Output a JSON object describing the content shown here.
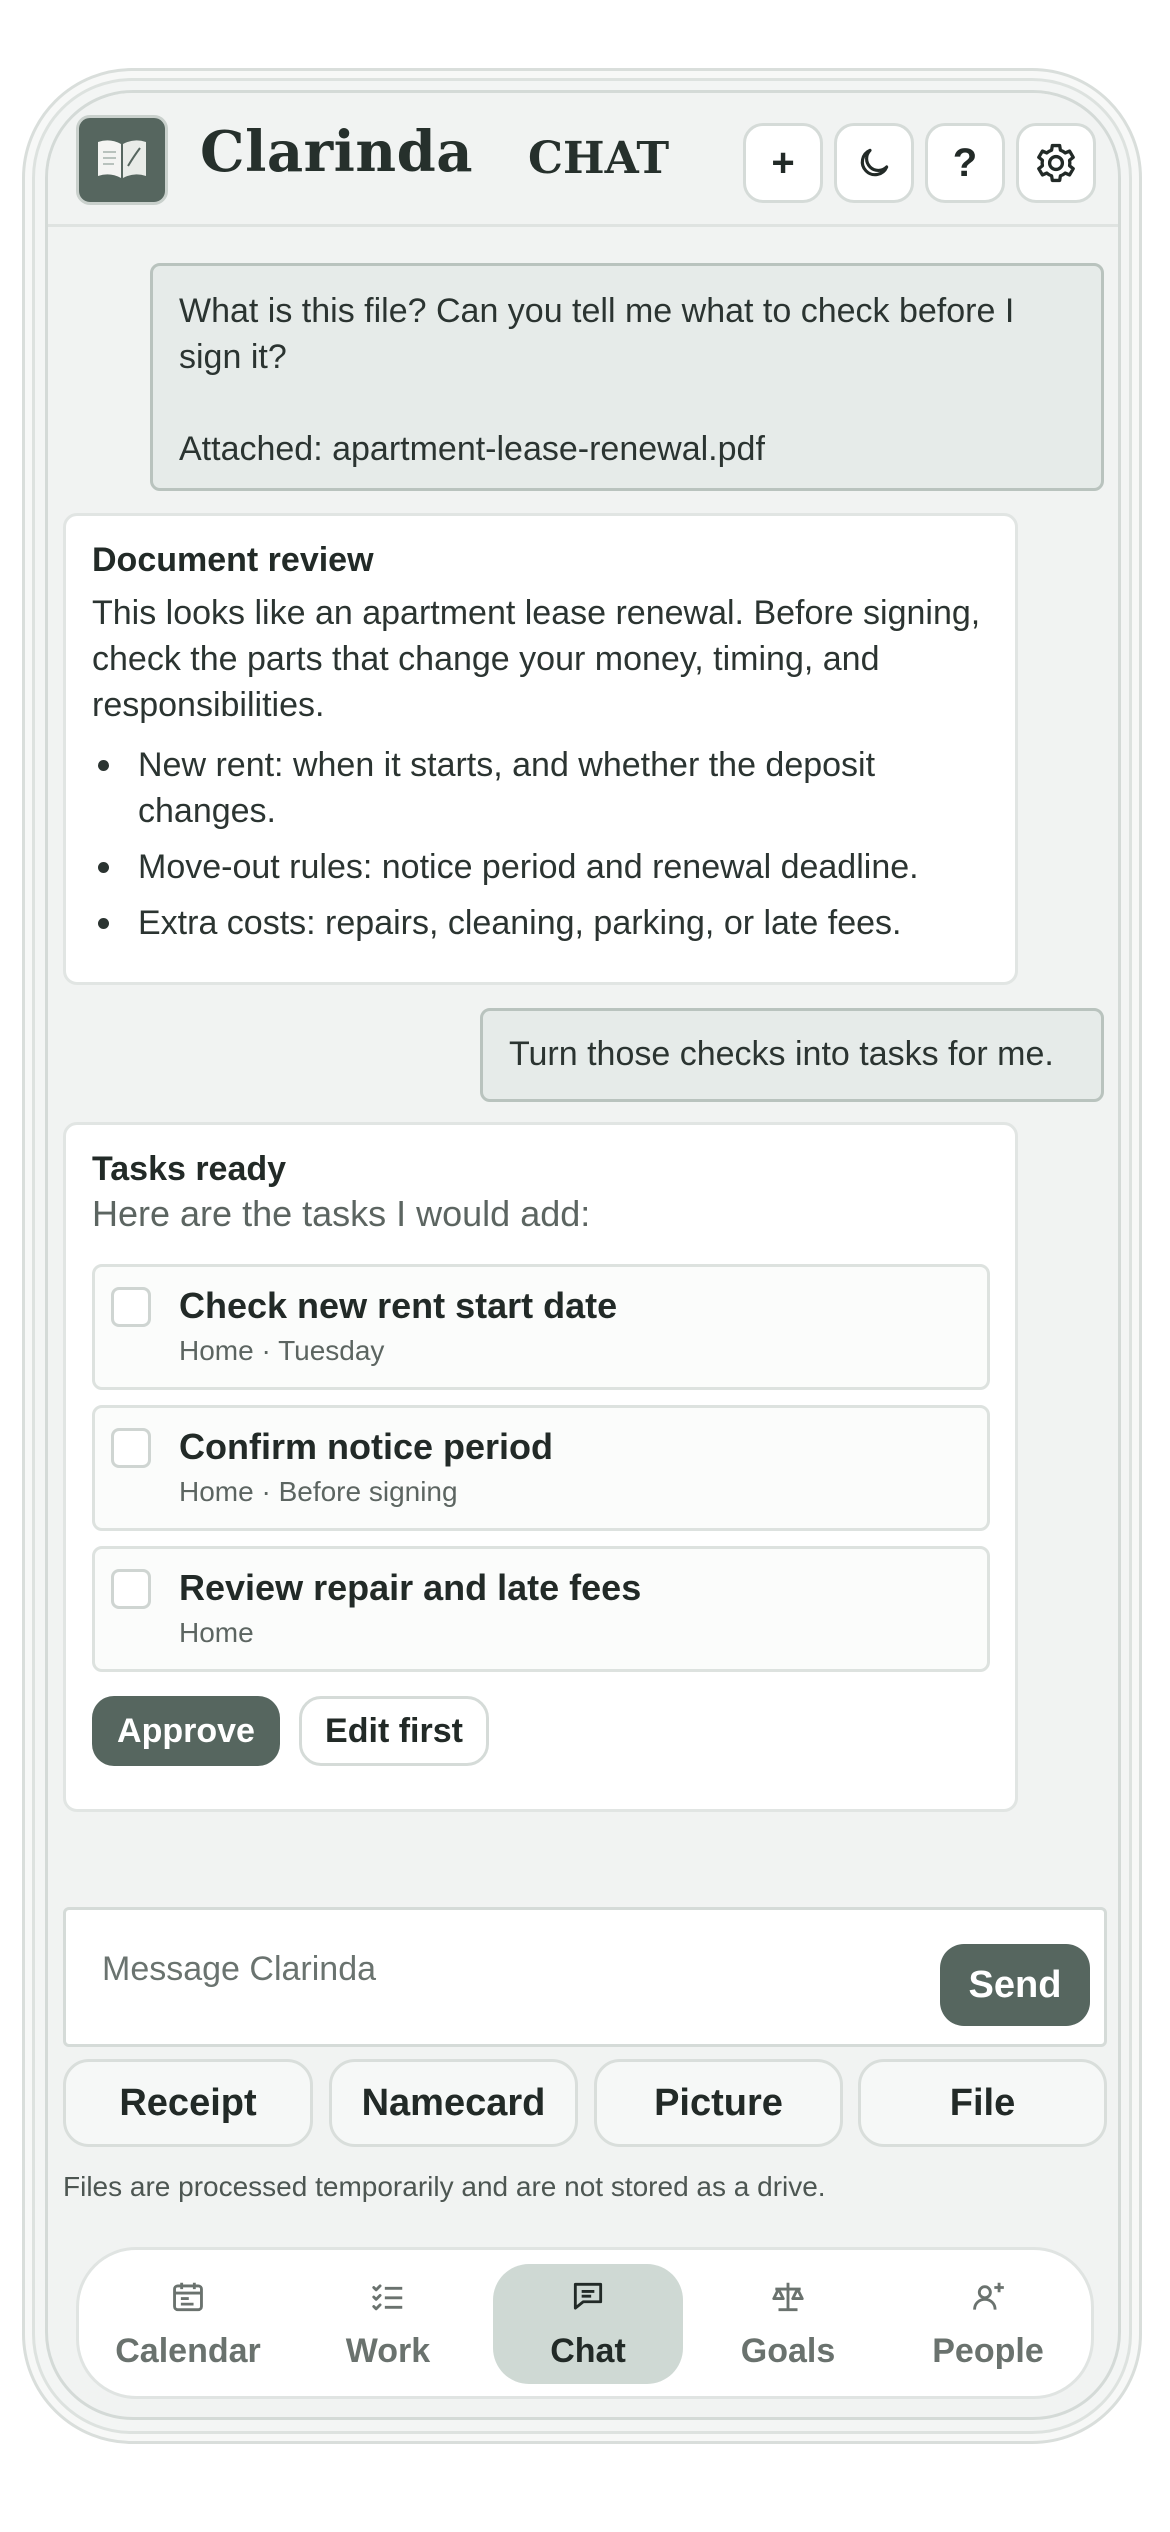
{
  "header": {
    "app_title": "Clarinda",
    "section": "CHAT",
    "buttons": [
      {
        "icon": "plus-icon",
        "label": "+"
      },
      {
        "icon": "moon-icon"
      },
      {
        "icon": "help-icon",
        "label": "?"
      },
      {
        "icon": "gear-icon"
      }
    ]
  },
  "messages": {
    "user1": {
      "text": "What is this file? Can you tell me what to check before I sign it?",
      "attachment": "Attached: apartment-lease-renewal.pdf"
    },
    "review": {
      "title": "Document review",
      "body": "This looks like an apartment lease renewal. Before signing, check the parts that change your money, timing, and responsibilities.",
      "bullets": [
        "New rent: when it starts, and whether the deposit changes.",
        "Move-out rules: notice period and renewal deadline.",
        "Extra costs: repairs, cleaning, parking, or late fees."
      ]
    },
    "user2": {
      "text": "Turn those checks into tasks for me."
    },
    "tasks": {
      "title": "Tasks ready",
      "subtitle": "Here are the tasks I would add:",
      "items": [
        {
          "title": "Check new rent start date",
          "meta": "Home · Tuesday",
          "checked": false
        },
        {
          "title": "Confirm notice period",
          "meta": "Home · Before signing",
          "checked": false
        },
        {
          "title": "Review repair and late fees",
          "meta": "Home",
          "checked": false
        }
      ],
      "approve_label": "Approve",
      "edit_label": "Edit first"
    }
  },
  "composer": {
    "placeholder": "Message Clarinda",
    "send_label": "Send"
  },
  "quick_actions": [
    "Receipt",
    "Namecard",
    "Picture",
    "File"
  ],
  "note": "Files are processed temporarily and are not stored as a drive.",
  "nav": {
    "active": "Chat",
    "items": [
      {
        "label": "Calendar",
        "icon": "calendar-icon"
      },
      {
        "label": "Work",
        "icon": "checklist-icon"
      },
      {
        "label": "Chat",
        "icon": "chat-icon"
      },
      {
        "label": "Goals",
        "icon": "scale-icon"
      },
      {
        "label": "People",
        "icon": "person-add-icon"
      }
    ]
  },
  "colors": {
    "accent": "#56665f",
    "background": "#f1f3f2",
    "nav_active": "#cfd9d4"
  }
}
